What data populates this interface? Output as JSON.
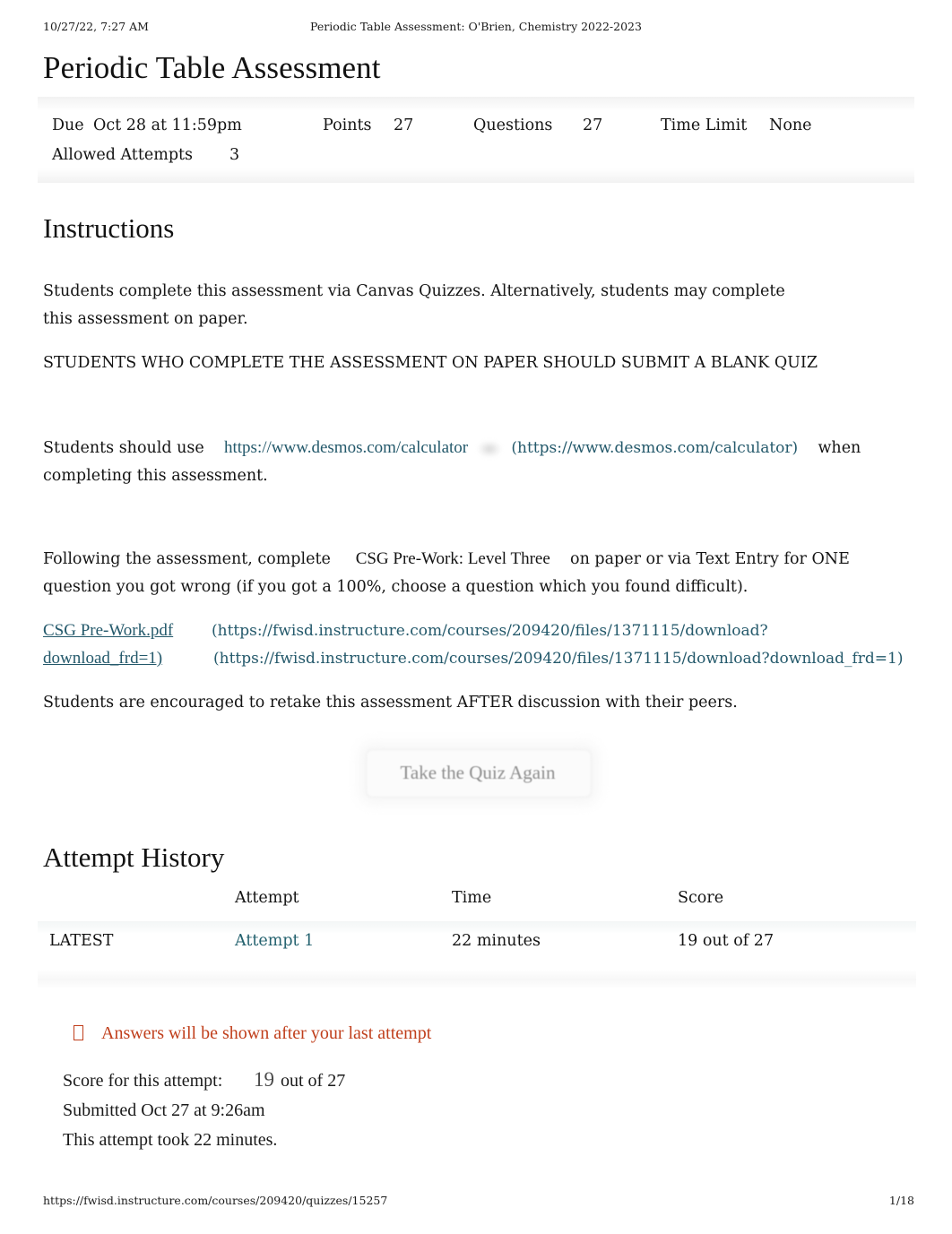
{
  "print_header": {
    "date": "10/27/22, 7:27 AM",
    "title": "Periodic Table Assessment: O'Brien, Chemistry 2022-2023"
  },
  "page_title": "Periodic Table Assessment",
  "quiz_details": {
    "due_label": "Due",
    "due_value": "Oct 28 at 11:59pm",
    "points_label": "Points",
    "points_value": "27",
    "questions_label": "Questions",
    "questions_value": "27",
    "time_limit_label": "Time Limit",
    "time_limit_value": "None",
    "allowed_attempts_label": "Allowed Attempts",
    "allowed_attempts_value": "3"
  },
  "instructions": {
    "heading": "Instructions",
    "para1": "Students complete this assessment via Canvas Quizzes. Alternatively, students may complete this assessment on paper.",
    "para2": "STUDENTS WHO COMPLETE THE ASSESSMENT ON PAPER SHOULD SUBMIT A BLANK QUIZ",
    "para3_before": "Students should use",
    "desmos_link_text": "https://www.desmos.com/calculator",
    "desmos_link_url": "(https://www.desmos.com/calculator)",
    "para3_after": "when completing this assessment.",
    "para4_before": "Following the assessment, complete",
    "csg_prework_title": "CSG Pre-Work: Level Three",
    "para4_after": "on paper or via Text Entry for ONE question you got wrong (if you got a 100%, choose a question which you found difficult).",
    "file_link_name_line1": "CSG Pre-Work.pdf",
    "file_link_name_line2": "download_frd=1)",
    "file_link_url_line1": "(https://fwisd.instructure.com/courses/209420/files/1371115/download?",
    "file_link_url_line2": "(https://fwisd.instructure.com/courses/209420/files/1371115/download?download_frd=1)",
    "para6": "Students are encouraged to retake this assessment AFTER discussion with their peers."
  },
  "take_quiz_again_button": "Take the Quiz Again",
  "attempt_history": {
    "heading": "Attempt History",
    "columns": [
      "",
      "Attempt",
      "Time",
      "Score"
    ],
    "rows": [
      {
        "status": "LATEST",
        "attempt": "Attempt 1",
        "time": "22 minutes",
        "score": "19 out of 27"
      }
    ]
  },
  "notice": {
    "icon": "warning-tofu-icon",
    "text": "Answers will be shown after your last attempt"
  },
  "score_summary": {
    "score_label": "Score for this attempt:",
    "score_value": "19",
    "score_outof": "out of 27",
    "submitted": "Submitted Oct 27 at 9:26am",
    "duration": "This attempt took 22 minutes."
  },
  "print_footer": {
    "url": "https://fwisd.instructure.com/courses/209420/quizzes/15257",
    "page": "1/18"
  },
  "colors": {
    "link": "#24596b",
    "notice": "#c03f1c",
    "text": "#1a1a1a"
  }
}
